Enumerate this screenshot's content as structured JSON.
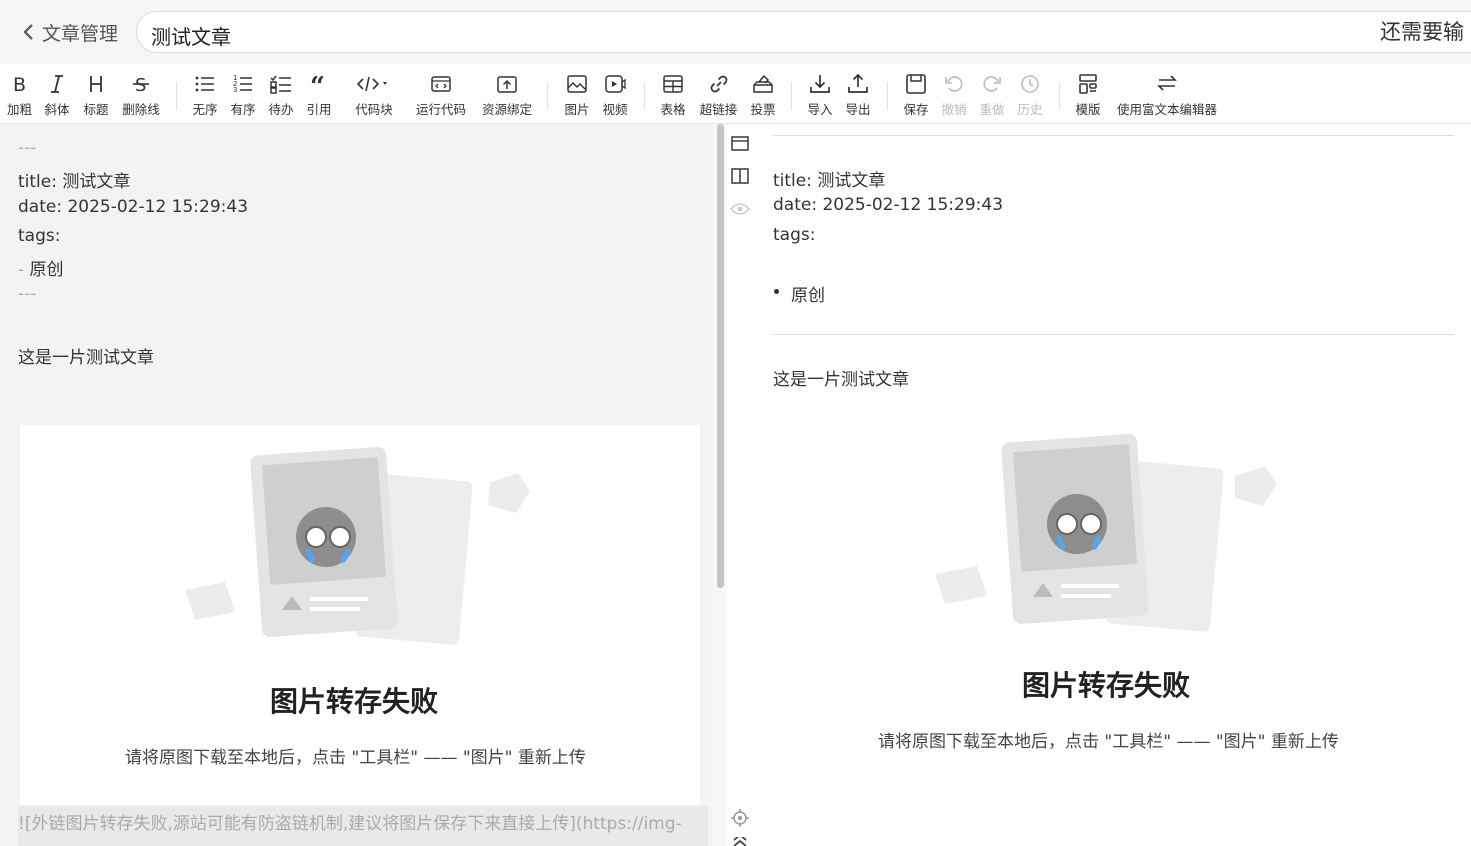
{
  "header": {
    "back_label": "文章管理",
    "title_value": "测试文章",
    "hint": "还需要输"
  },
  "toolbar": {
    "bold": "加粗",
    "italic": "斜体",
    "heading": "标题",
    "strike": "删除线",
    "ul": "无序",
    "ol": "有序",
    "todo": "待办",
    "quote": "引用",
    "code": "代码块",
    "run": "运行代码",
    "resource": "资源绑定",
    "image": "图片",
    "video": "视频",
    "table": "表格",
    "link": "超链接",
    "vote": "投票",
    "import": "导入",
    "export": "导出",
    "save": "保存",
    "undo": "撤销",
    "redo": "重做",
    "history": "历史",
    "template": "模版",
    "richtext": "使用富文本编辑器"
  },
  "editor": {
    "fm_open": "---",
    "title_line": "title: 测试文章",
    "date_line": "date: 2025-02-12 15:29:43",
    "tags_line": "tags:",
    "tag_dash": "- ",
    "tag_item": "原创",
    "fm_close": "---",
    "body": "这是一片测试文章",
    "img_md": "![外链图片转存失败,源站可能有防盗链机制,建议将图片保存下来直接上传](https://img-"
  },
  "preview": {
    "title_line": "title: 测试文章",
    "date_line": "date: 2025-02-12 15:29:43",
    "tags_line": "tags:",
    "tag_item": "原创",
    "body": "这是一片测试文章"
  },
  "image_failure": {
    "title": "图片转存失败",
    "desc": "请将原图下载至本地后，点击 \"工具栏\" —— \"图片\" 重新上传"
  },
  "colors": {
    "notify_dot": "#e53935",
    "editor_bg": "#f3f3f3",
    "header_bg": "#f5f5f5"
  }
}
